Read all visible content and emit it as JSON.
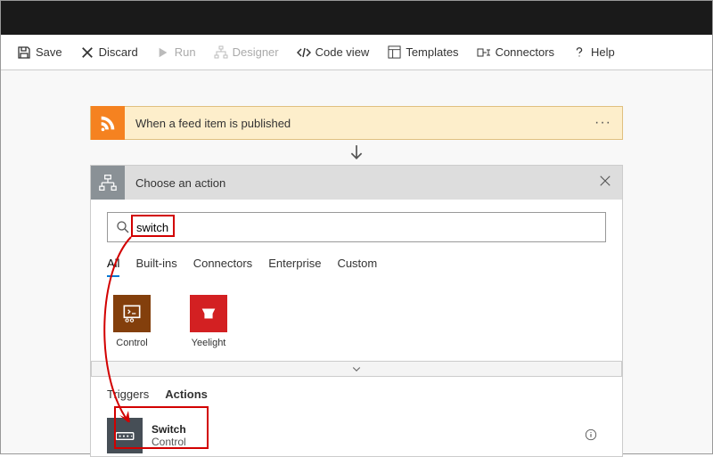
{
  "toolbar": {
    "save": "Save",
    "discard": "Discard",
    "run": "Run",
    "designer": "Designer",
    "codeview": "Code view",
    "templates": "Templates",
    "connectors": "Connectors",
    "help": "Help"
  },
  "trigger": {
    "label": "When a feed item is published"
  },
  "panel": {
    "title": "Choose an action",
    "search_value": "switch",
    "tabs": [
      "All",
      "Built-ins",
      "Connectors",
      "Enterprise",
      "Custom"
    ],
    "connectors": [
      {
        "name": "Control"
      },
      {
        "name": "Yeelight"
      }
    ],
    "subtabs": [
      "Triggers",
      "Actions"
    ],
    "action": {
      "title": "Switch",
      "subtitle": "Control"
    }
  }
}
